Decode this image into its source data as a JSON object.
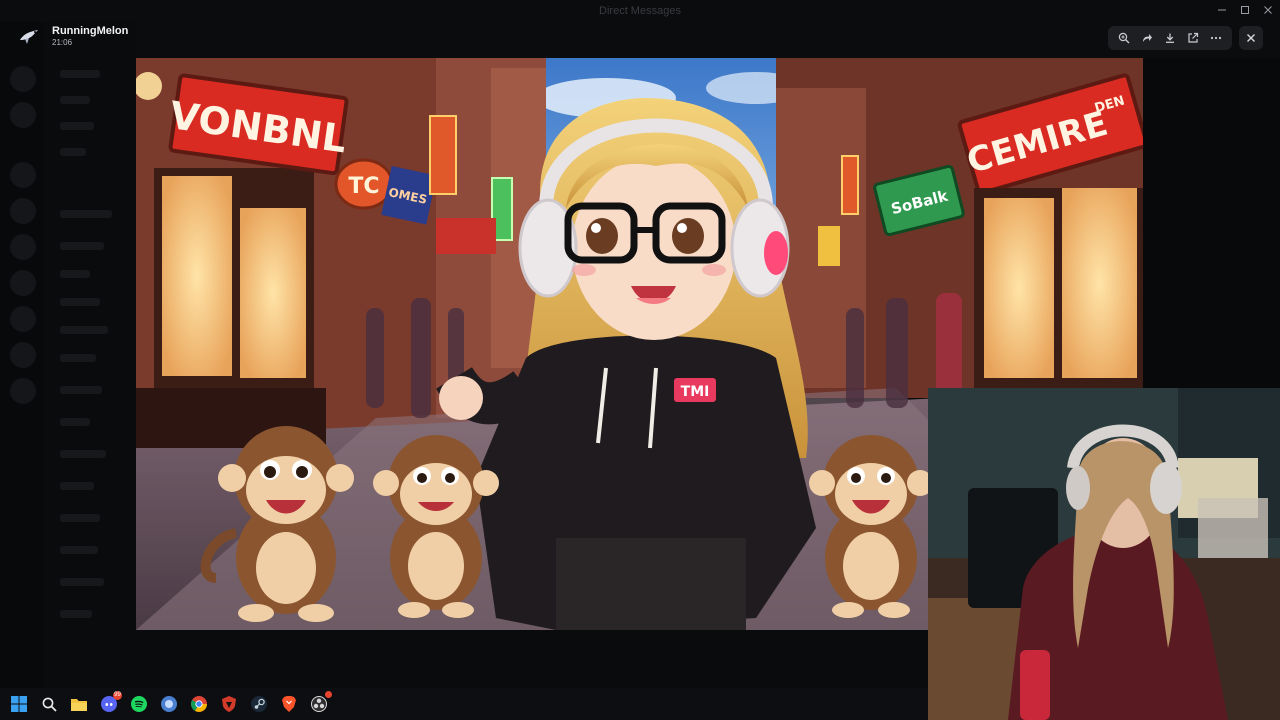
{
  "app": {
    "window_title": "Direct Messages"
  },
  "viewer": {
    "user_name": "RunningMelon",
    "timestamp": "21:06",
    "tools": [
      "zoom-in-icon",
      "forward-icon",
      "download-icon",
      "open-external-icon",
      "more-icon"
    ]
  },
  "artwork": {
    "sign_left": "VONBNL",
    "sign_tc": "TC",
    "sign_tc_sub": "OMES",
    "sign_right": "CEMIRE",
    "sign_right_small": "DEN",
    "sign_green": "SoBalk",
    "hoodie_badge": "TMI"
  },
  "taskbar": {
    "icons": [
      "windows-start-icon",
      "search-icon",
      "file-explorer-icon",
      "discord-icon",
      "spotify-icon",
      "app-icon",
      "chrome-icon",
      "shield-app-icon",
      "steam-icon",
      "brave-icon",
      "obs-icon"
    ],
    "discord_badge": "99"
  },
  "colors": {
    "accent_red": "#e8442f",
    "sky": "#7fb7e8",
    "viewer_button_bg": "#1e1f22"
  }
}
